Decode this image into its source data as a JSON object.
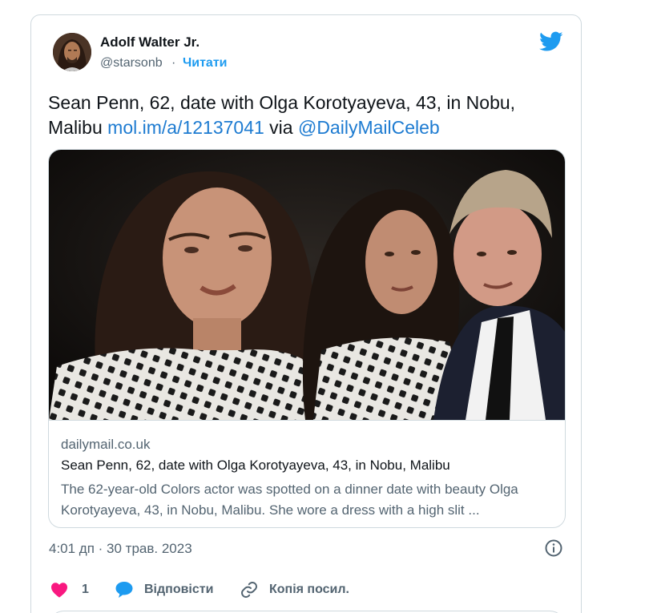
{
  "author": {
    "name": "Adolf Walter Jr.",
    "handle": "@starsonb",
    "separator": "·",
    "follow_label": "Читати"
  },
  "tweet": {
    "text_plain": "Sean Penn, 62, date with Olga Korotyayeva, 43, in Nobu, Malibu ",
    "link": "mol.im/a/12137041",
    "via": " via ",
    "mention": "@DailyMailCeleb"
  },
  "card": {
    "domain": "dailymail.co.uk",
    "title": "Sean Penn, 62, date with Olga Korotyayeva, 43, in Nobu, Malibu",
    "description": "The 62-year-old Colors actor was spotted on a dinner date with beauty Olga Korotyayeva, 43, in Nobu, Malibu. She wore a dress with a high slit ..."
  },
  "timestamp": "4:01 дп · 30 трав. 2023",
  "actions": {
    "like_count": "1",
    "reply_label": "Відповісти",
    "copy_label": "Копія посил."
  },
  "icons": {
    "brand_blue": "#1d9bf0",
    "like": "heart-icon",
    "reply": "speech-bubble-icon",
    "copy": "link-icon",
    "info": "info-icon",
    "logo": "twitter-bird-icon"
  }
}
